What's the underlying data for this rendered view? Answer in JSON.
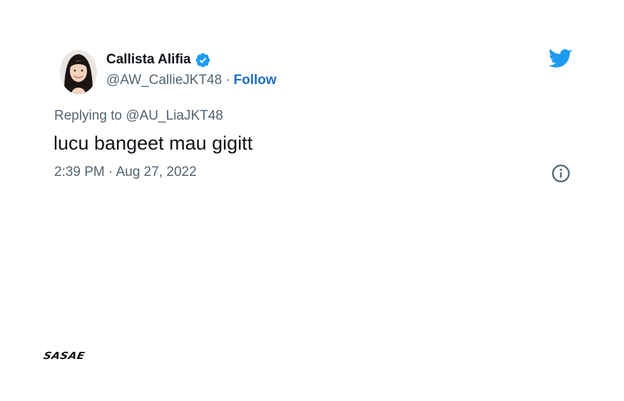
{
  "author": {
    "display_name": "Callista Alifia",
    "handle": "@AW_CallieJKT48",
    "separator": "·",
    "follow_label": "Follow",
    "verified": true
  },
  "reply": {
    "prefix": "Replying to",
    "mention": "@AU_LiaJKT48"
  },
  "tweet": {
    "text": "lucu bangeet mau gigitt",
    "timestamp": "2:39 PM · Aug 27, 2022"
  },
  "icons": {
    "platform_logo": "twitter-bird-icon",
    "verified": "verified-badge-icon",
    "info": "info-icon"
  },
  "watermark": {
    "brand": "SASAE"
  },
  "colors": {
    "twitter_blue": "#1d9bf0",
    "follow_link": "#1d6fc2",
    "secondary_text": "#536471",
    "primary_text": "#0f1419"
  }
}
